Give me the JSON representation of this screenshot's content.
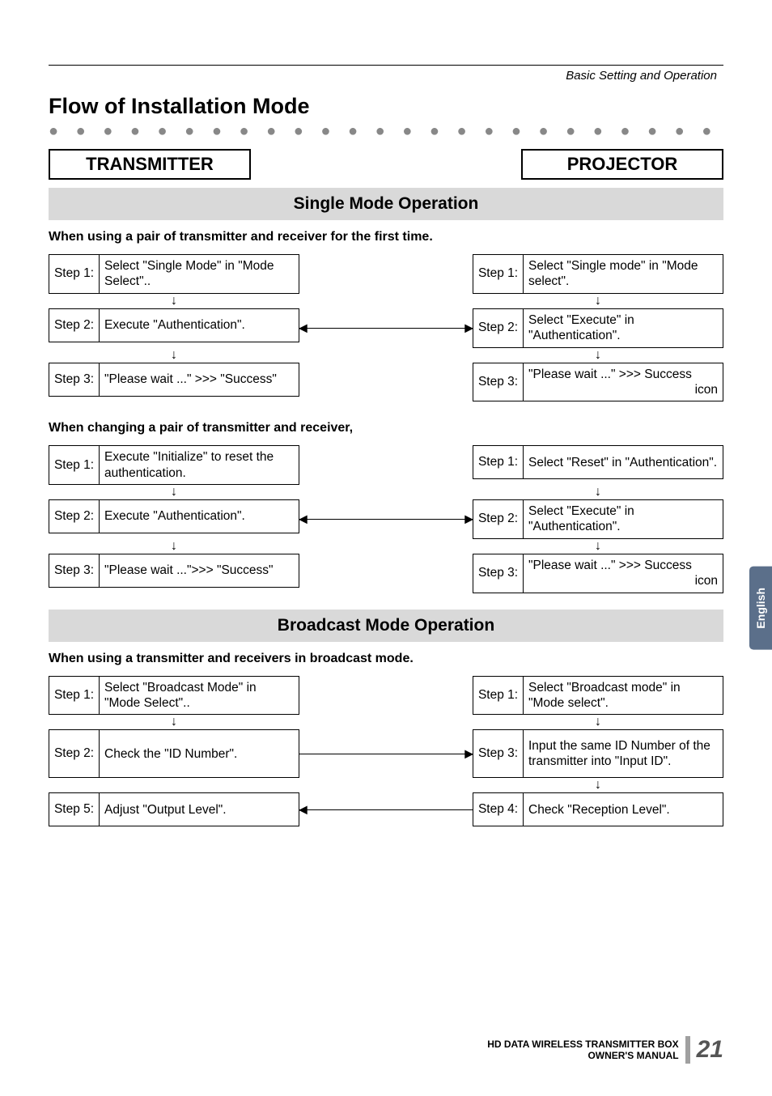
{
  "breadcrumb": "Basic Setting and  Operation",
  "title": "Flow of Installation Mode",
  "columns": {
    "left": "TRANSMITTER",
    "right": "PROJECTOR"
  },
  "lang_tab": "English",
  "sections": {
    "single": {
      "band": "Single Mode Operation",
      "sub1": "When using a pair of transmitter and receiver for the first time.",
      "tx1": {
        "s1l": "Step 1:",
        "s1t": "Select \"Single Mode\" in \"Mode Select\"..",
        "s2l": "Step 2:",
        "s2t": "Execute \"Authentication\".",
        "s3l": "Step 3:",
        "s3t": "\"Please wait ...\" >>> \"Success\""
      },
      "pj1": {
        "s1l": "Step 1:",
        "s1t": "Select \"Single mode\" in \"Mode select\".",
        "s2l": "Step 2:",
        "s2t": "Select \"Execute\" in \"Authentication\".",
        "s3l": "Step 3:",
        "s3t_a": "\"Please wait ...\" >>> Success",
        "s3t_b": "icon"
      },
      "sub2": "When changing a pair of transmitter and receiver,",
      "tx2": {
        "s1l": "Step 1:",
        "s1t": "Execute \"Initialize\" to reset the authentication.",
        "s2l": "Step 2:",
        "s2t": "Execute \"Authentication\".",
        "s3l": "Step 3:",
        "s3t": "\"Please wait ...\">>> \"Success\""
      },
      "pj2": {
        "s1l": "Step 1:",
        "s1t": "Select \"Reset\" in \"Authentication\".",
        "s2l": "Step 2:",
        "s2t": "Select \"Execute\" in \"Authentication\".",
        "s3l": "Step 3:",
        "s3t_a": "\"Please wait ...\" >>> Success",
        "s3t_b": "icon"
      }
    },
    "broadcast": {
      "band": "Broadcast Mode Operation",
      "sub": "When using a transmitter and receivers in broadcast mode.",
      "tx": {
        "s1l": "Step 1:",
        "s1t": "Select \"Broadcast Mode\" in \"Mode Select\"..",
        "s2l": "Step 2:",
        "s2t": "Check the \"ID Number\".",
        "s5l": "Step 5:",
        "s5t": "Adjust \"Output Level\"."
      },
      "pj": {
        "s1l": "Step 1:",
        "s1t": "Select \"Broadcast mode\" in \"Mode select\".",
        "s3l": "Step 3:",
        "s3t": "Input the same ID Number of the transmitter into \"Input ID\".",
        "s4l": "Step 4:",
        "s4t": "Check \"Reception Level\"."
      }
    }
  },
  "footer": {
    "line1": "HD DATA WIRELESS TRANSMITTER BOX",
    "line2": "OWNER'S MANUAL",
    "page": "21"
  },
  "glyphs": {
    "down": "↓",
    "left_head": "◀",
    "right_head": "▶"
  }
}
